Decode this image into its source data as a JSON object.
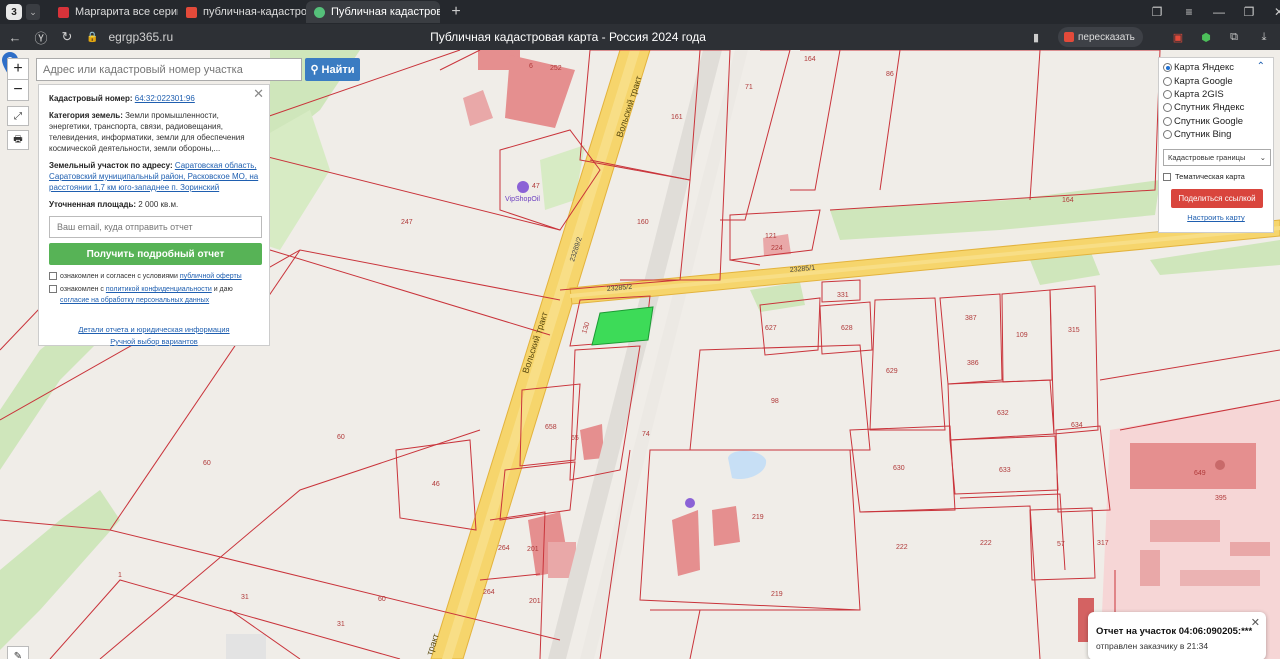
{
  "browser": {
    "tab_count": "3",
    "tabs": [
      {
        "title": "Маргарита все серии 202",
        "icon_color": "#d8333a",
        "icon": "kinopoisk-icon"
      },
      {
        "title": "публичная-кадастровая",
        "icon_color": "#e34a3a",
        "icon": "yandex-icon"
      },
      {
        "title": "Публичная кадастровая",
        "icon_color": "#55c07a",
        "icon": "egrp-icon",
        "active": true
      }
    ],
    "url": "egrgp365.ru",
    "page_title": "Публичная кадастровая карта - Россия 2024 года",
    "retell_label": "пересказать"
  },
  "map": {
    "search": {
      "placeholder": "Адрес или кадастровый номер участка",
      "button": "Найти"
    },
    "zoom_in": "+",
    "zoom_out": "−",
    "info": {
      "cad_label": "Кадастровый номер:",
      "cad_value": "64:32:022301:96",
      "cat_label": "Категория земель:",
      "cat_value": "Земли промышленности, энергетики, транспорта, связи, радиовещания, телевидения, информатики, земли для обеспечения космической деятельности, земли обороны,...",
      "addr_label": "Земельный участок по адресу:",
      "addr_value": "Саратовская область, Саратовский муниципальный район, Расковское МО, на расстоянии 1,7 км юго-западнее п. Зоринский",
      "area_label": "Уточненная площадь:",
      "area_value": "2 000 кв.м.",
      "email_placeholder": "Ваш email, куда отправить отчет",
      "get_report": "Получить подробный отчет",
      "agree1_text": "ознакомлен и согласен с условиями",
      "agree1_link": "публичной оферты",
      "agree2_text": "ознакомлен с",
      "agree2_link": "политикой конфиденциальности",
      "agree2_tail": "и даю",
      "agree2_link2": "согласие на обработку персональных данных",
      "link_details": "Детали отчета и юридическая информация",
      "link_manual": "Ручной выбор вариантов"
    },
    "layers": {
      "options": [
        "Карта Яндекс",
        "Карта Google",
        "Карта 2GIS",
        "Спутник Яндекс",
        "Спутник Google",
        "Спутник Bing"
      ],
      "selected": 0,
      "boundary_select": "Кадастровые границы",
      "thematic": "Тематическая карта",
      "share": "Поделиться ссылкой",
      "configure": "Настроить карту"
    },
    "toast": {
      "line1": "Отчет на участок 04:06:090205:***",
      "line2": "отправлен заказчику в 21:34"
    },
    "labels": {
      "road_volsky_1": "Вольский тракт",
      "road_volsky_2": "Вольский тракт",
      "road_volsky_3": "тракт",
      "road_23285_1": "23285/1",
      "road_23285_2": "23285/2",
      "road_23289_2": "23289/2",
      "poi_vipshop": "VipShopOil",
      "parcels": [
        "252",
        "6",
        "161",
        "86",
        "164",
        "71",
        "247",
        "160",
        "47",
        "121",
        "224",
        "164",
        "331",
        "627",
        "628",
        "387",
        "109",
        "315",
        "386",
        "629",
        "98",
        "632",
        "634",
        "60",
        "60",
        "658",
        "65",
        "46",
        "630",
        "633",
        "649",
        "395",
        "219",
        "264",
        "201",
        "222",
        "222",
        "57",
        "317",
        "31",
        "60",
        "1",
        "31",
        "264",
        "201",
        "219",
        "130",
        "74"
      ]
    }
  }
}
